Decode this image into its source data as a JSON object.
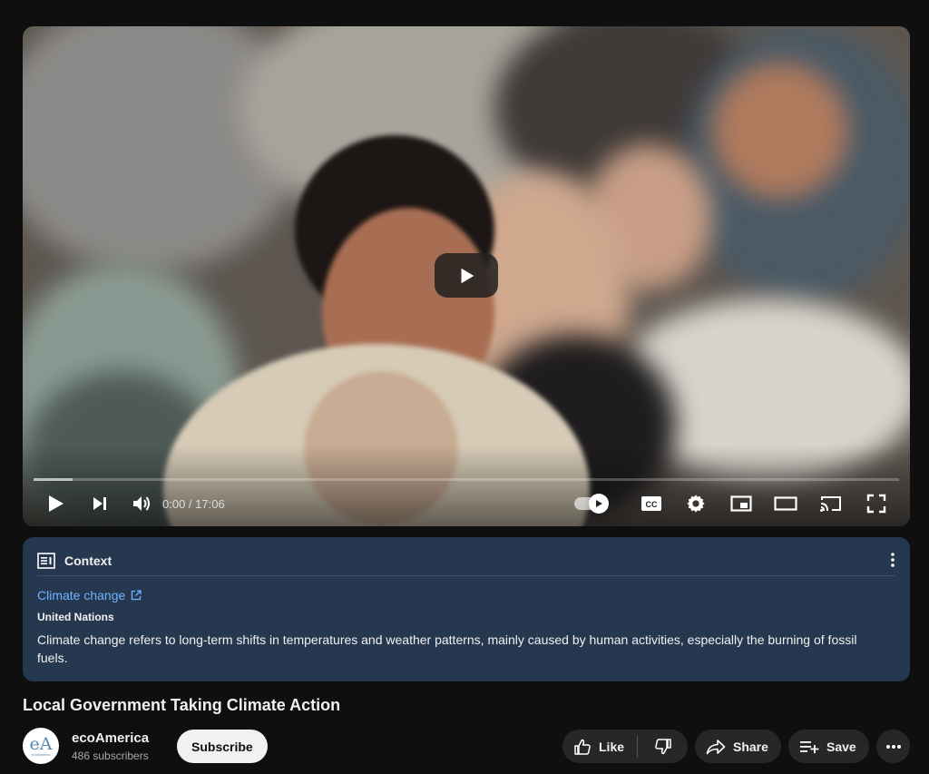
{
  "player": {
    "time_label": "0:00 / 17:06",
    "progress_fraction": 0.045
  },
  "context": {
    "heading": "Context",
    "topic_link": "Climate change",
    "source": "United Nations",
    "description": "Climate change refers to long-term shifts in temperatures and weather patterns, mainly caused by human activities, especially the burning of fossil fuels."
  },
  "video": {
    "title": "Local Government Taking Climate Action"
  },
  "channel": {
    "avatar_text": "eA",
    "avatar_caption": "ecoAmerica",
    "name": "ecoAmerica",
    "subscribers": "486 subscribers",
    "subscribe_label": "Subscribe"
  },
  "actions": {
    "like_label": "Like",
    "share_label": "Share",
    "save_label": "Save"
  },
  "colors": {
    "page_bg": "#0f0f0f",
    "context_bg": "#263850",
    "link": "#6fb3ff",
    "pill_bg": "#272727"
  }
}
